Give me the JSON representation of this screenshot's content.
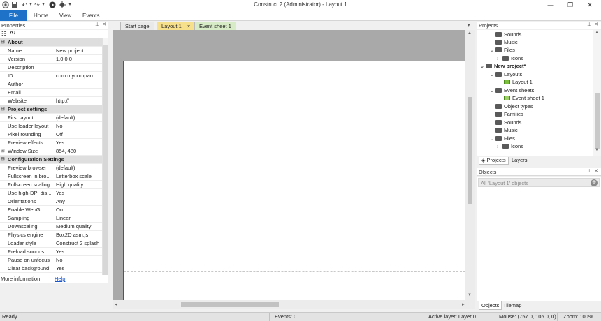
{
  "window": {
    "title": "Construct 2 (Administrator) - Layout 1",
    "minimize_icon": "minimize-icon",
    "restore_icon": "restore-icon",
    "close_icon": "close-icon"
  },
  "ribbon": {
    "file": "File",
    "home": "Home",
    "view": "View",
    "events": "Events"
  },
  "properties": {
    "header": "Properties",
    "more_info_label": "More information",
    "help_link": "Help",
    "groups": [
      {
        "name": "About",
        "rows": [
          {
            "name": "Name",
            "value": "New project"
          },
          {
            "name": "Version",
            "value": "1.0.0.0"
          },
          {
            "name": "Description",
            "value": ""
          },
          {
            "name": "ID",
            "value": "com.mycompan..."
          },
          {
            "name": "Author",
            "value": ""
          },
          {
            "name": "Email",
            "value": ""
          },
          {
            "name": "Website",
            "value": "http://"
          }
        ]
      },
      {
        "name": "Project settings",
        "rows": [
          {
            "name": "First layout",
            "value": "(default)"
          },
          {
            "name": "Use loader layout",
            "value": "No"
          },
          {
            "name": "Pixel rounding",
            "value": "Off"
          },
          {
            "name": "Preview effects",
            "value": "Yes"
          },
          {
            "name": "Window Size",
            "value": "854, 480"
          }
        ]
      },
      {
        "name": "Configuration Settings",
        "rows": [
          {
            "name": "Preview browser",
            "value": "(default)"
          },
          {
            "name": "Fullscreen in bro...",
            "value": "Letterbox scale"
          },
          {
            "name": "Fullscreen scaling",
            "value": "High quality"
          },
          {
            "name": "Use high-DPI dis...",
            "value": "Yes"
          },
          {
            "name": "Orientations",
            "value": "Any"
          },
          {
            "name": "Enable WebGL",
            "value": "On"
          },
          {
            "name": "Sampling",
            "value": "Linear"
          },
          {
            "name": "Downscaling",
            "value": "Medium quality"
          },
          {
            "name": "Physics engine",
            "value": "Box2D asm.js"
          },
          {
            "name": "Loader style",
            "value": "Construct 2 splash"
          },
          {
            "name": "Preload sounds",
            "value": "Yes"
          },
          {
            "name": "Pause on unfocus",
            "value": "No"
          },
          {
            "name": "Clear background",
            "value": "Yes"
          }
        ]
      }
    ]
  },
  "tabs": {
    "start_page": "Start page",
    "layout1": "Layout 1",
    "layout1_close": "×",
    "event_sheet1": "Event sheet 1"
  },
  "projects": {
    "header": "Projects",
    "items": [
      {
        "label": "Sounds"
      },
      {
        "label": "Music"
      },
      {
        "label": "Files"
      },
      {
        "label": "Icons"
      },
      {
        "label": "New project*"
      },
      {
        "label": "Layouts"
      },
      {
        "label": "Layout 1"
      },
      {
        "label": "Event sheets"
      },
      {
        "label": "Event sheet 1"
      },
      {
        "label": "Object types"
      },
      {
        "label": "Families"
      },
      {
        "label": "Sounds"
      },
      {
        "label": "Music"
      },
      {
        "label": "Files"
      },
      {
        "label": "Icons"
      }
    ],
    "tab_projects": "Projects",
    "tab_layers": "Layers"
  },
  "objects": {
    "header": "Objects",
    "filter_placeholder": "All 'Layout 1' objects",
    "tab_objects": "Objects",
    "tab_tilemap": "Tilemap"
  },
  "status": {
    "ready": "Ready",
    "events": "Events: 0",
    "active_layer": "Active layer: Layer 0",
    "mouse": "Mouse: (757.0, 105.0, 0)",
    "zoom": "Zoom: 100%"
  },
  "colors": {
    "file_button": "#1e73c8",
    "active_tab": "#f7e08c",
    "event_tab": "#d7ebc6"
  }
}
